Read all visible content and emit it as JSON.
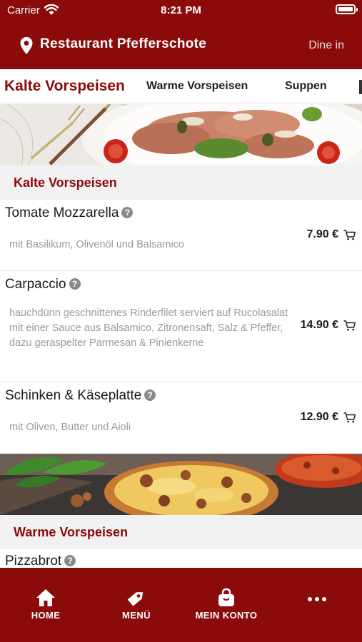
{
  "status_bar": {
    "carrier": "Carrier",
    "time": "8:21 PM"
  },
  "header": {
    "restaurant_name": "Restaurant Pfefferschote",
    "mode": "Dine in"
  },
  "tabs": [
    {
      "label": "Kalte Vorspeisen",
      "active": true
    },
    {
      "label": "Warme Vorspeisen",
      "active": false
    },
    {
      "label": "Suppen",
      "active": false
    }
  ],
  "sections": [
    {
      "title": "Kalte Vorspeisen",
      "items": [
        {
          "name": "Tomate Mozzarella",
          "description": "mit Basilikum, Olivenöl und Balsamico",
          "price": "7.90 €"
        },
        {
          "name": "Carpaccio",
          "description": "hauchdünn geschnittenes Rinderfilet serviert auf Rucolasalat mit einer Sauce aus Balsamico, Zitronensaft, Salz & Pfeffer, dazu geraspelter Parmesan & Pinienkerne",
          "price": "14.90 €"
        },
        {
          "name": "Schinken & Käseplatte",
          "description": "mit Oliven, Butter und Aioli",
          "price": "12.90 €"
        }
      ]
    },
    {
      "title": "Warme Vorspeisen",
      "items": [
        {
          "name": "Pizzabrot"
        }
      ]
    }
  ],
  "info_icon_glyph": "?",
  "bottom_nav": [
    {
      "label": "HOME",
      "icon": "home-icon"
    },
    {
      "label": "MENÜ",
      "icon": "tag-icon"
    },
    {
      "label": "MEIN KONTO",
      "icon": "bag-icon"
    },
    {
      "label": "",
      "icon": "more-icon"
    }
  ],
  "colors": {
    "brand": "#8b0a0a",
    "section_bg": "#f1f1f1",
    "muted_text": "#9a9a9a"
  }
}
